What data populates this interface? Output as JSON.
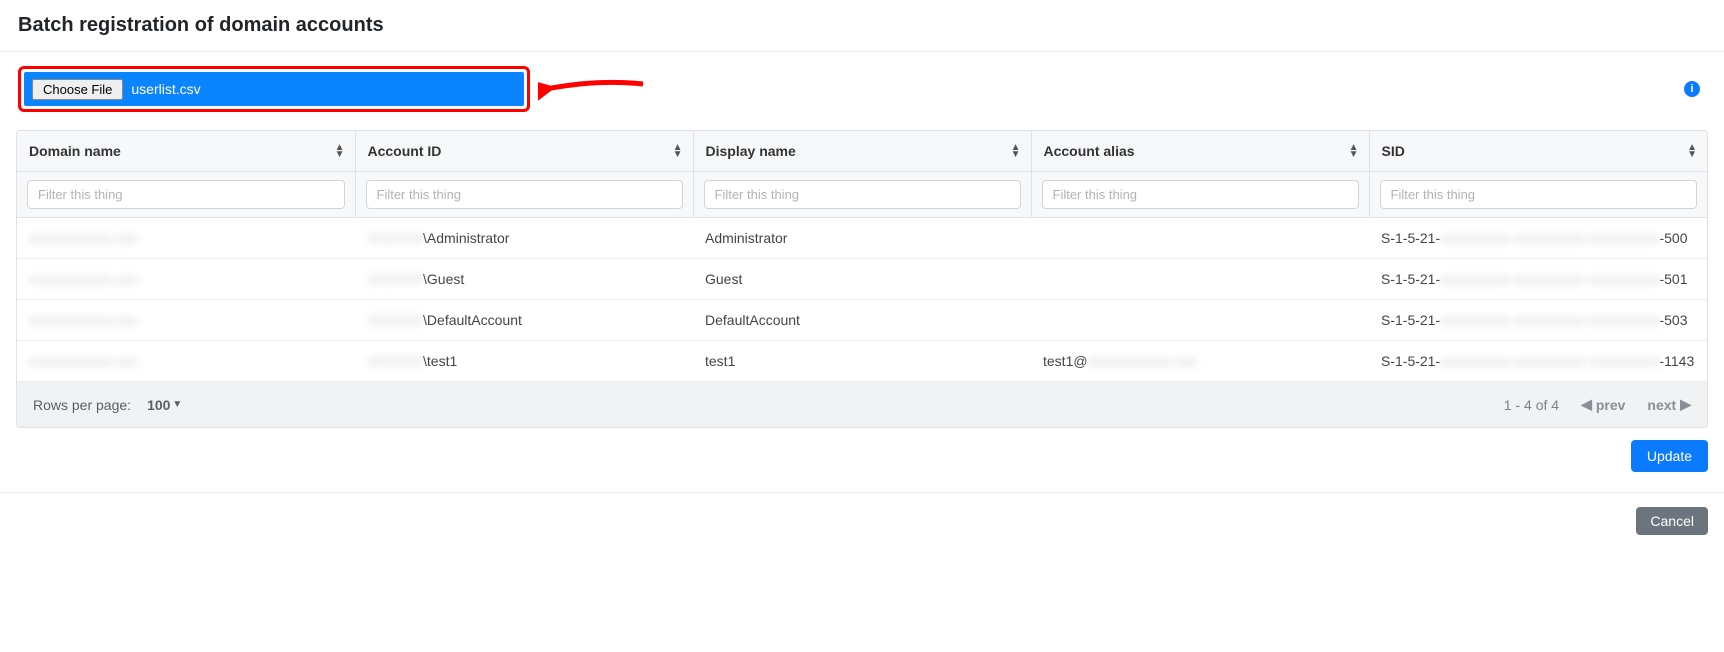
{
  "header": {
    "title": "Batch registration of domain accounts"
  },
  "file_picker": {
    "button_label": "Choose File",
    "filename": "userlist.csv"
  },
  "info_icon": {
    "glyph": "i"
  },
  "table": {
    "columns": [
      {
        "label": "Domain name"
      },
      {
        "label": "Account ID"
      },
      {
        "label": "Display name"
      },
      {
        "label": "Account alias"
      },
      {
        "label": "SID"
      }
    ],
    "filter_placeholder": "Filter this thing",
    "rows": [
      {
        "domain_blur": "xxxxxxxxxxxx.xxx",
        "account_blur": "XXXXXX",
        "account_suffix": "\\Administrator",
        "display": "Administrator",
        "alias_text": "",
        "alias_blur": "",
        "sid_prefix": "S-1-5-21-",
        "sid_blur": "xxxxxxxxxx-xxxxxxxxxx-xxxxxxxxxx",
        "sid_suffix": "-500"
      },
      {
        "domain_blur": "xxxxxxxxxxxx.xxx",
        "account_blur": "XXXXXX",
        "account_suffix": "\\Guest",
        "display": "Guest",
        "alias_text": "",
        "alias_blur": "",
        "sid_prefix": "S-1-5-21-",
        "sid_blur": "xxxxxxxxxx-xxxxxxxxxx-xxxxxxxxxx",
        "sid_suffix": "-501"
      },
      {
        "domain_blur": "xxxxxxxxxxxx.xxx",
        "account_blur": "XXXXXX",
        "account_suffix": "\\DefaultAccount",
        "display": "DefaultAccount",
        "alias_text": "",
        "alias_blur": "",
        "sid_prefix": "S-1-5-21-",
        "sid_blur": "xxxxxxxxxx-xxxxxxxxxx-xxxxxxxxxx",
        "sid_suffix": "-503"
      },
      {
        "domain_blur": "xxxxxxxxxxxx.xxx",
        "account_blur": "XXXXXX",
        "account_suffix": "\\test1",
        "display": "test1",
        "alias_text": "test1@",
        "alias_blur": "xxxxxxxxxxxx.xxx",
        "sid_prefix": "S-1-5-21-",
        "sid_blur": "xxxxxxxxxx-xxxxxxxxxx-xxxxxxxxxx",
        "sid_suffix": "-1143"
      }
    ]
  },
  "footer": {
    "rows_per_page_label": "Rows per page:",
    "rows_per_page_value": "100",
    "range": "1 - 4 of 4",
    "prev_label": "prev",
    "next_label": "next"
  },
  "buttons": {
    "update": "Update",
    "cancel": "Cancel"
  }
}
